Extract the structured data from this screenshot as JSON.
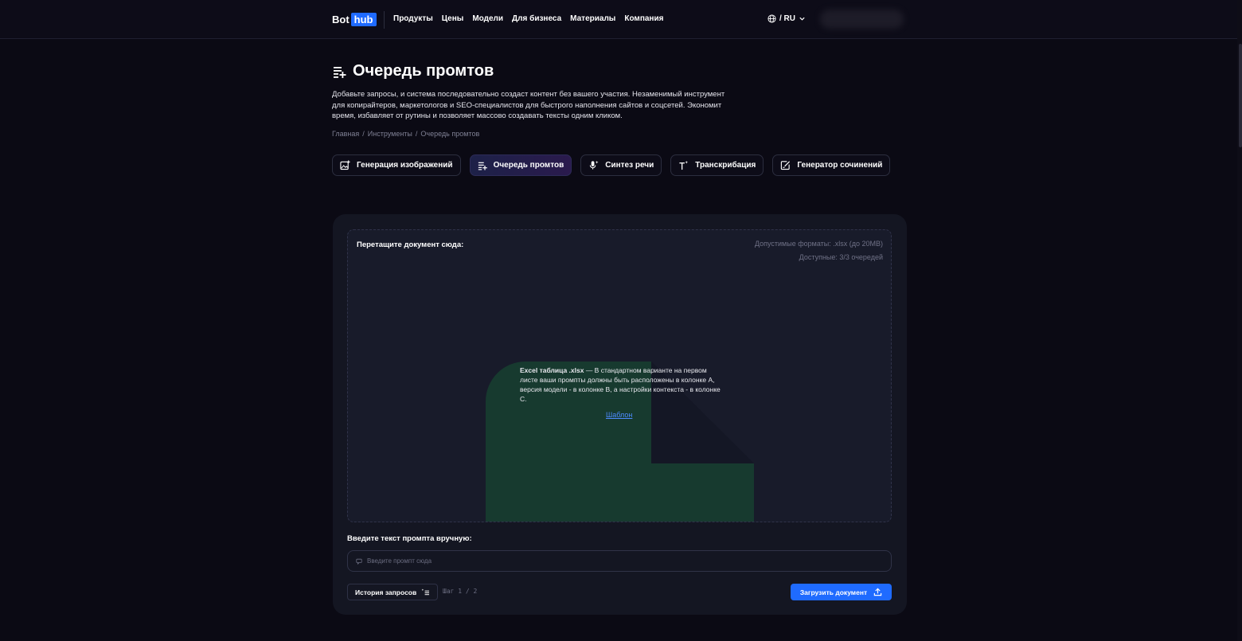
{
  "header": {
    "logo": {
      "bot": "Bot",
      "hub": "hub"
    },
    "nav": [
      "Продукты",
      "Цены",
      "Модели",
      "Для бизнеса",
      "Материалы",
      "Компания"
    ],
    "lang": "/ RU"
  },
  "page": {
    "title": "Очередь промтов",
    "description": "Добавьте запросы, и система последовательно создаст контент без вашего участия. Незаменимый инструмент для копирайтеров, маркетологов и SEO-специалистов для быстрого наполнения сайтов и соцсетей. Экономит время, избавляет от рутины и позволяет массово создавать тексты одним кликом.",
    "breadcrumb": [
      "Главная",
      "/",
      "Инструменты",
      "/",
      "Очередь промтов"
    ]
  },
  "tabs": [
    {
      "label": "Генерация изображений",
      "icon": "image-plus-icon",
      "active": false
    },
    {
      "label": "Очередь промтов",
      "icon": "queue-list-icon",
      "active": true
    },
    {
      "label": "Синтез речи",
      "icon": "microphone-sparkle-icon",
      "active": false
    },
    {
      "label": "Транскрибация",
      "icon": "text-sparkle-icon",
      "active": false
    },
    {
      "label": "Генератор сочинений",
      "icon": "edit-note-icon",
      "active": false
    }
  ],
  "dropzone": {
    "title": "Перетащите документ сюда:",
    "formats": "Допустимые форматы: .xlsx (до 20MB)",
    "available": "Доступные: 3/3 очередей",
    "info_bold": "Excel таблица .xlsx",
    "info_text": " — В стандартном варианте на первом листе ваши промпты должны быть расположены в колонке А, версия модели - в колонке В, а настройки контекста - в колонке С.",
    "template_link": "Шаблон"
  },
  "manual": {
    "label": "Введите текст промпта вручную:",
    "placeholder": "Введите промпт сюда",
    "value": ""
  },
  "footer": {
    "history_label": "История запросов",
    "step": "Шаг 1 / 2",
    "upload_label": "Загрузить документ"
  },
  "colors": {
    "background": "#0b0a14",
    "panel": "#141622",
    "accent": "#1f6bff",
    "excel_green": "#173a2f"
  }
}
